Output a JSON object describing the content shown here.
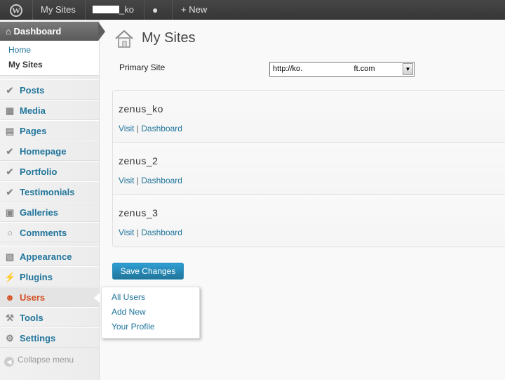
{
  "admin_bar": {
    "logo": "W",
    "my_sites": "My Sites",
    "site_name_suffix": "_ko",
    "comments_icon": "speech-bubble-icon",
    "new_label": "+ New"
  },
  "sidebar": {
    "dashboard": {
      "label": "Dashboard",
      "icon": "home-icon"
    },
    "submenu": [
      {
        "label": "Home"
      },
      {
        "label": "My Sites"
      }
    ],
    "items": [
      {
        "label": "Posts",
        "icon": "pin-icon"
      },
      {
        "label": "Media",
        "icon": "media-icon"
      },
      {
        "label": "Pages",
        "icon": "pages-icon"
      },
      {
        "label": "Homepage",
        "icon": "pin-icon"
      },
      {
        "label": "Portfolio",
        "icon": "pin-icon"
      },
      {
        "label": "Testimonials",
        "icon": "pin-icon"
      },
      {
        "label": "Galleries",
        "icon": "gallery-icon"
      },
      {
        "label": "Comments",
        "icon": "comment-icon"
      },
      {
        "label": "Appearance",
        "icon": "appearance-icon"
      },
      {
        "label": "Plugins",
        "icon": "plug-icon"
      },
      {
        "label": "Users",
        "icon": "users-icon"
      },
      {
        "label": "Tools",
        "icon": "tools-icon"
      },
      {
        "label": "Settings",
        "icon": "settings-icon"
      }
    ],
    "collapse": "Collapse menu"
  },
  "users_flyout": [
    {
      "label": "All Users"
    },
    {
      "label": "Add New"
    },
    {
      "label": "Your Profile"
    }
  ],
  "main": {
    "title": "My Sites",
    "primary_site_label": "Primary Site",
    "primary_site_value": "http://ko.                        ft.com",
    "sites": [
      {
        "name": "zenus_ko",
        "visit": "Visit",
        "sep": "|",
        "dashboard": "Dashboard"
      },
      {
        "name": "zenus_2",
        "visit": "Visit",
        "sep": "|",
        "dashboard": "Dashboard"
      },
      {
        "name": "zenus_3",
        "visit": "Visit",
        "sep": "|",
        "dashboard": "Dashboard"
      }
    ],
    "save_label": "Save Changes"
  },
  "colors": {
    "accent": "#21759b",
    "active": "#d54e21",
    "adminbar": "#464646"
  }
}
